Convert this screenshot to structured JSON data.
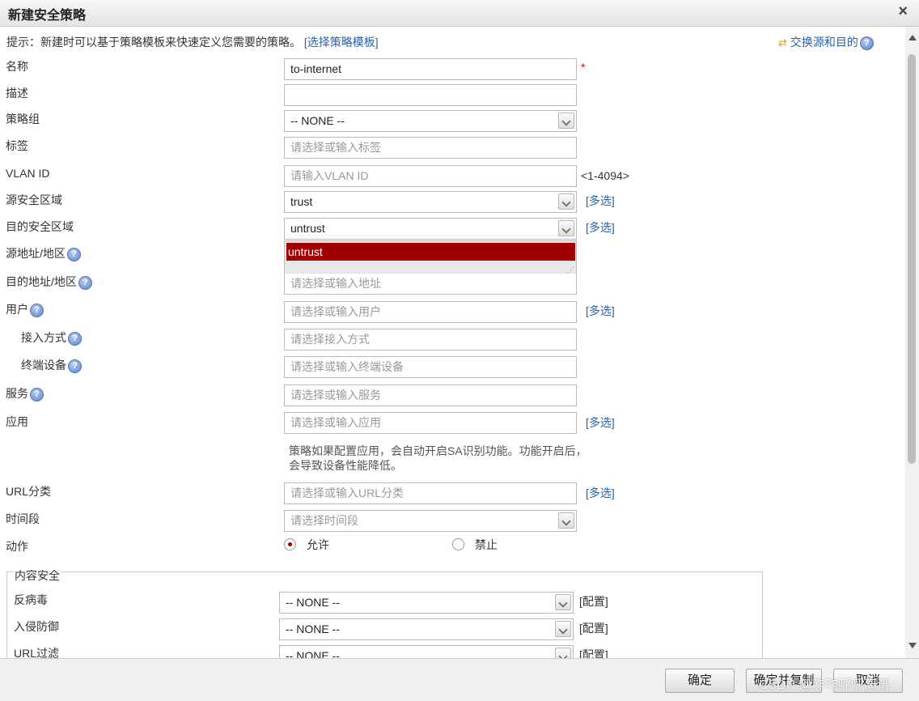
{
  "dialog": {
    "title": "新建安全策略",
    "close_glyph": "×"
  },
  "hint": {
    "text": "提示：新建时可以基于策略模板来快速定义您需要的策略。",
    "link": "[选择策略模板]"
  },
  "swap_link": "交换源和目的",
  "form": {
    "name": {
      "label": "名称",
      "value": "to-internet",
      "required": "*"
    },
    "description": {
      "label": "描述",
      "value": ""
    },
    "policy_group": {
      "label": "策略组",
      "value": "-- NONE --"
    },
    "tag": {
      "label": "标签",
      "placeholder": "请选择或输入标签"
    },
    "vlan_id": {
      "label": "VLAN ID",
      "placeholder": "请输入VLAN ID",
      "range": "<1-4094>"
    },
    "src_zone": {
      "label": "源安全区域",
      "value": "trust",
      "multi": "[多选]"
    },
    "dst_zone": {
      "label": "目的安全区域",
      "value": "untrust",
      "multi": "[多选]",
      "options": [
        "untrust"
      ]
    },
    "src_addr": {
      "label": "源地址/地区"
    },
    "dst_addr": {
      "label": "目的地址/地区",
      "placeholder": "请选择或输入地址"
    },
    "user": {
      "label": "用户",
      "placeholder": "请选择或输入用户",
      "multi": "[多选]"
    },
    "access_mode": {
      "label": "接入方式",
      "placeholder": "请选择接入方式"
    },
    "terminal": {
      "label": "终端设备",
      "placeholder": "请选择或输入终端设备"
    },
    "service": {
      "label": "服务",
      "placeholder": "请选择或输入服务"
    },
    "application": {
      "label": "应用",
      "placeholder": "请选择或输入应用",
      "multi": "[多选]",
      "note": "策略如果配置应用，会自动开启SA识别功能。功能开启后，会导致设备性能降低。"
    },
    "url_category": {
      "label": "URL分类",
      "placeholder": "请选择或输入URL分类",
      "multi": "[多选]"
    },
    "time_range": {
      "label": "时间段",
      "placeholder": "请选择时间段"
    },
    "action": {
      "label": "动作",
      "allow": "允许",
      "deny": "禁止",
      "selected": "允许"
    }
  },
  "content_security": {
    "legend": "内容安全",
    "antivirus": {
      "label": "反病毒",
      "value": "-- NONE --",
      "config": "[配置]"
    },
    "ips": {
      "label": "入侵防御",
      "value": "-- NONE --",
      "config": "[配置]"
    },
    "url_filter": {
      "label": "URL过滤",
      "value": "-- NONE --",
      "config": "[配置]"
    }
  },
  "footer": {
    "ok": "确定",
    "ok_copy": "确定并复制",
    "cancel": "取消"
  },
  "watermark": "CSDN @咋咋呼呼离谱",
  "colors": {
    "accent": "#a10000",
    "link": "#2862a8"
  }
}
